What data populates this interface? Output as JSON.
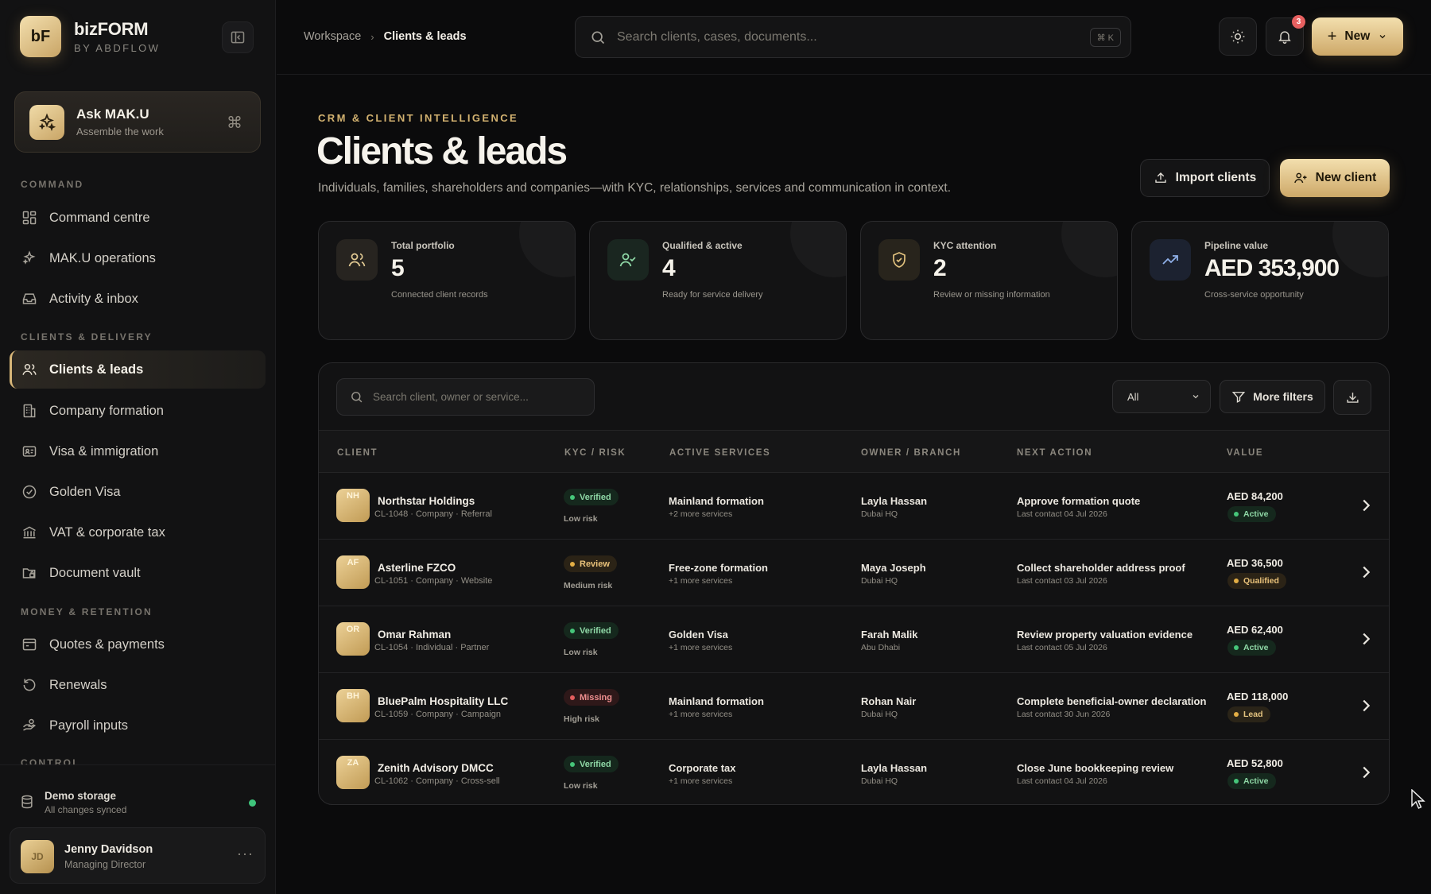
{
  "brand": {
    "logo": "bF",
    "name": "bizFORM",
    "sub": "BY ABDFLOW"
  },
  "ask": {
    "title": "Ask MAK.U",
    "sub": "Assemble the work",
    "shortcut": "⌘"
  },
  "sidebar": {
    "sections": [
      "COMMAND",
      "CLIENTS & DELIVERY",
      "MONEY & RETENTION",
      "CONTROL"
    ],
    "items": [
      {
        "label": "Command centre",
        "icon": "grid-icon"
      },
      {
        "label": "MAK.U operations",
        "icon": "sparkles-icon"
      },
      {
        "label": "Activity & inbox",
        "icon": "inbox-icon"
      },
      {
        "label": "Clients & leads",
        "icon": "users-icon",
        "active": true
      },
      {
        "label": "Company formation",
        "icon": "building-icon"
      },
      {
        "label": "Visa & immigration",
        "icon": "id-card-icon"
      },
      {
        "label": "Golden Visa",
        "icon": "badge-check-icon"
      },
      {
        "label": "VAT & corporate tax",
        "icon": "bank-icon"
      },
      {
        "label": "Document vault",
        "icon": "folder-lock-icon"
      },
      {
        "label": "Quotes & payments",
        "icon": "receipt-icon"
      },
      {
        "label": "Renewals",
        "icon": "refresh-icon"
      },
      {
        "label": "Payroll inputs",
        "icon": "payroll-icon"
      }
    ]
  },
  "storage": {
    "title": "Demo storage",
    "sub": "All changes synced"
  },
  "user": {
    "initials": "JD",
    "name": "Jenny Davidson",
    "role": "Managing Director",
    "more": "···"
  },
  "topbar": {
    "crumb_1": "Workspace",
    "crumb_sep": "›",
    "crumb_2": "Clients & leads",
    "search_placeholder": "Search clients, cases, documents...",
    "search_kbd": "⌘ K",
    "notif_count": "3",
    "new_label": "New"
  },
  "header": {
    "eyebrow": "CRM & CLIENT INTELLIGENCE",
    "title": "Clients & leads",
    "desc": "Individuals, families, shareholders and companies—with KYC, relationships, services and communication in context.",
    "import_label": "Import clients",
    "new_client_label": "New client"
  },
  "stats": [
    {
      "label": "Total portfolio",
      "value": "5",
      "sub": "Connected client records",
      "icon": "users-icon"
    },
    {
      "label": "Qualified & active",
      "value": "4",
      "sub": "Ready for service delivery",
      "icon": "user-check-icon"
    },
    {
      "label": "KYC attention",
      "value": "2",
      "sub": "Review or missing information",
      "icon": "shield-check-icon"
    },
    {
      "label": "Pipeline value",
      "value": "AED 353,900",
      "sub": "Cross-service opportunity",
      "icon": "trend-up-icon"
    }
  ],
  "table": {
    "search_placeholder": "Search client, owner or service...",
    "filter_value": "All",
    "more_filters": "More filters",
    "columns": [
      "CLIENT",
      "KYC / RISK",
      "ACTIVE SERVICES",
      "OWNER / BRANCH",
      "NEXT ACTION",
      "VALUE"
    ],
    "rows": [
      {
        "initials": "NH",
        "name": "Northstar Holdings",
        "meta": "CL-1048 · Company · Referral",
        "kyc": "Verified",
        "kyc_type": "verified",
        "risk": "Low risk",
        "service": "Mainland formation",
        "service_more": "+2 more services",
        "owner": "Layla Hassan",
        "branch": "Dubai HQ",
        "next": "Approve formation quote",
        "last": "Last contact 04 Jul 2026",
        "value": "AED 84,200",
        "status": "Active",
        "status_type": "active"
      },
      {
        "initials": "AF",
        "name": "Asterline FZCO",
        "meta": "CL-1051 · Company · Website",
        "kyc": "Review",
        "kyc_type": "review",
        "risk": "Medium risk",
        "service": "Free-zone formation",
        "service_more": "+1 more services",
        "owner": "Maya Joseph",
        "branch": "Dubai HQ",
        "next": "Collect shareholder address proof",
        "last": "Last contact 03 Jul 2026",
        "value": "AED 36,500",
        "status": "Qualified",
        "status_type": "qualified"
      },
      {
        "initials": "OR",
        "name": "Omar Rahman",
        "meta": "CL-1054 · Individual · Partner",
        "kyc": "Verified",
        "kyc_type": "verified",
        "risk": "Low risk",
        "service": "Golden Visa",
        "service_more": "+1 more services",
        "owner": "Farah Malik",
        "branch": "Abu Dhabi",
        "next": "Review property valuation evidence",
        "last": "Last contact 05 Jul 2026",
        "value": "AED 62,400",
        "status": "Active",
        "status_type": "active"
      },
      {
        "initials": "BH",
        "name": "BluePalm Hospitality LLC",
        "meta": "CL-1059 · Company · Campaign",
        "kyc": "Missing",
        "kyc_type": "missing",
        "risk": "High risk",
        "service": "Mainland formation",
        "service_more": "+1 more services",
        "owner": "Rohan Nair",
        "branch": "Dubai HQ",
        "next": "Complete beneficial-owner declaration",
        "last": "Last contact 30 Jun 2026",
        "value": "AED 118,000",
        "status": "Lead",
        "status_type": "lead"
      },
      {
        "initials": "ZA",
        "name": "Zenith Advisory DMCC",
        "meta": "CL-1062 · Company · Cross-sell",
        "kyc": "Verified",
        "kyc_type": "verified",
        "risk": "Low risk",
        "service": "Corporate tax",
        "service_more": "+1 more services",
        "owner": "Layla Hassan",
        "branch": "Dubai HQ",
        "next": "Close June bookkeeping review",
        "last": "Last contact 04 Jul 2026",
        "value": "AED 52,800",
        "status": "Active",
        "status_type": "active"
      }
    ]
  },
  "colors": {
    "accent": "#d7b678",
    "bg": "#0b0b0c",
    "success": "#46c67a",
    "warning": "#e3ae45",
    "danger": "#e45e5e"
  }
}
